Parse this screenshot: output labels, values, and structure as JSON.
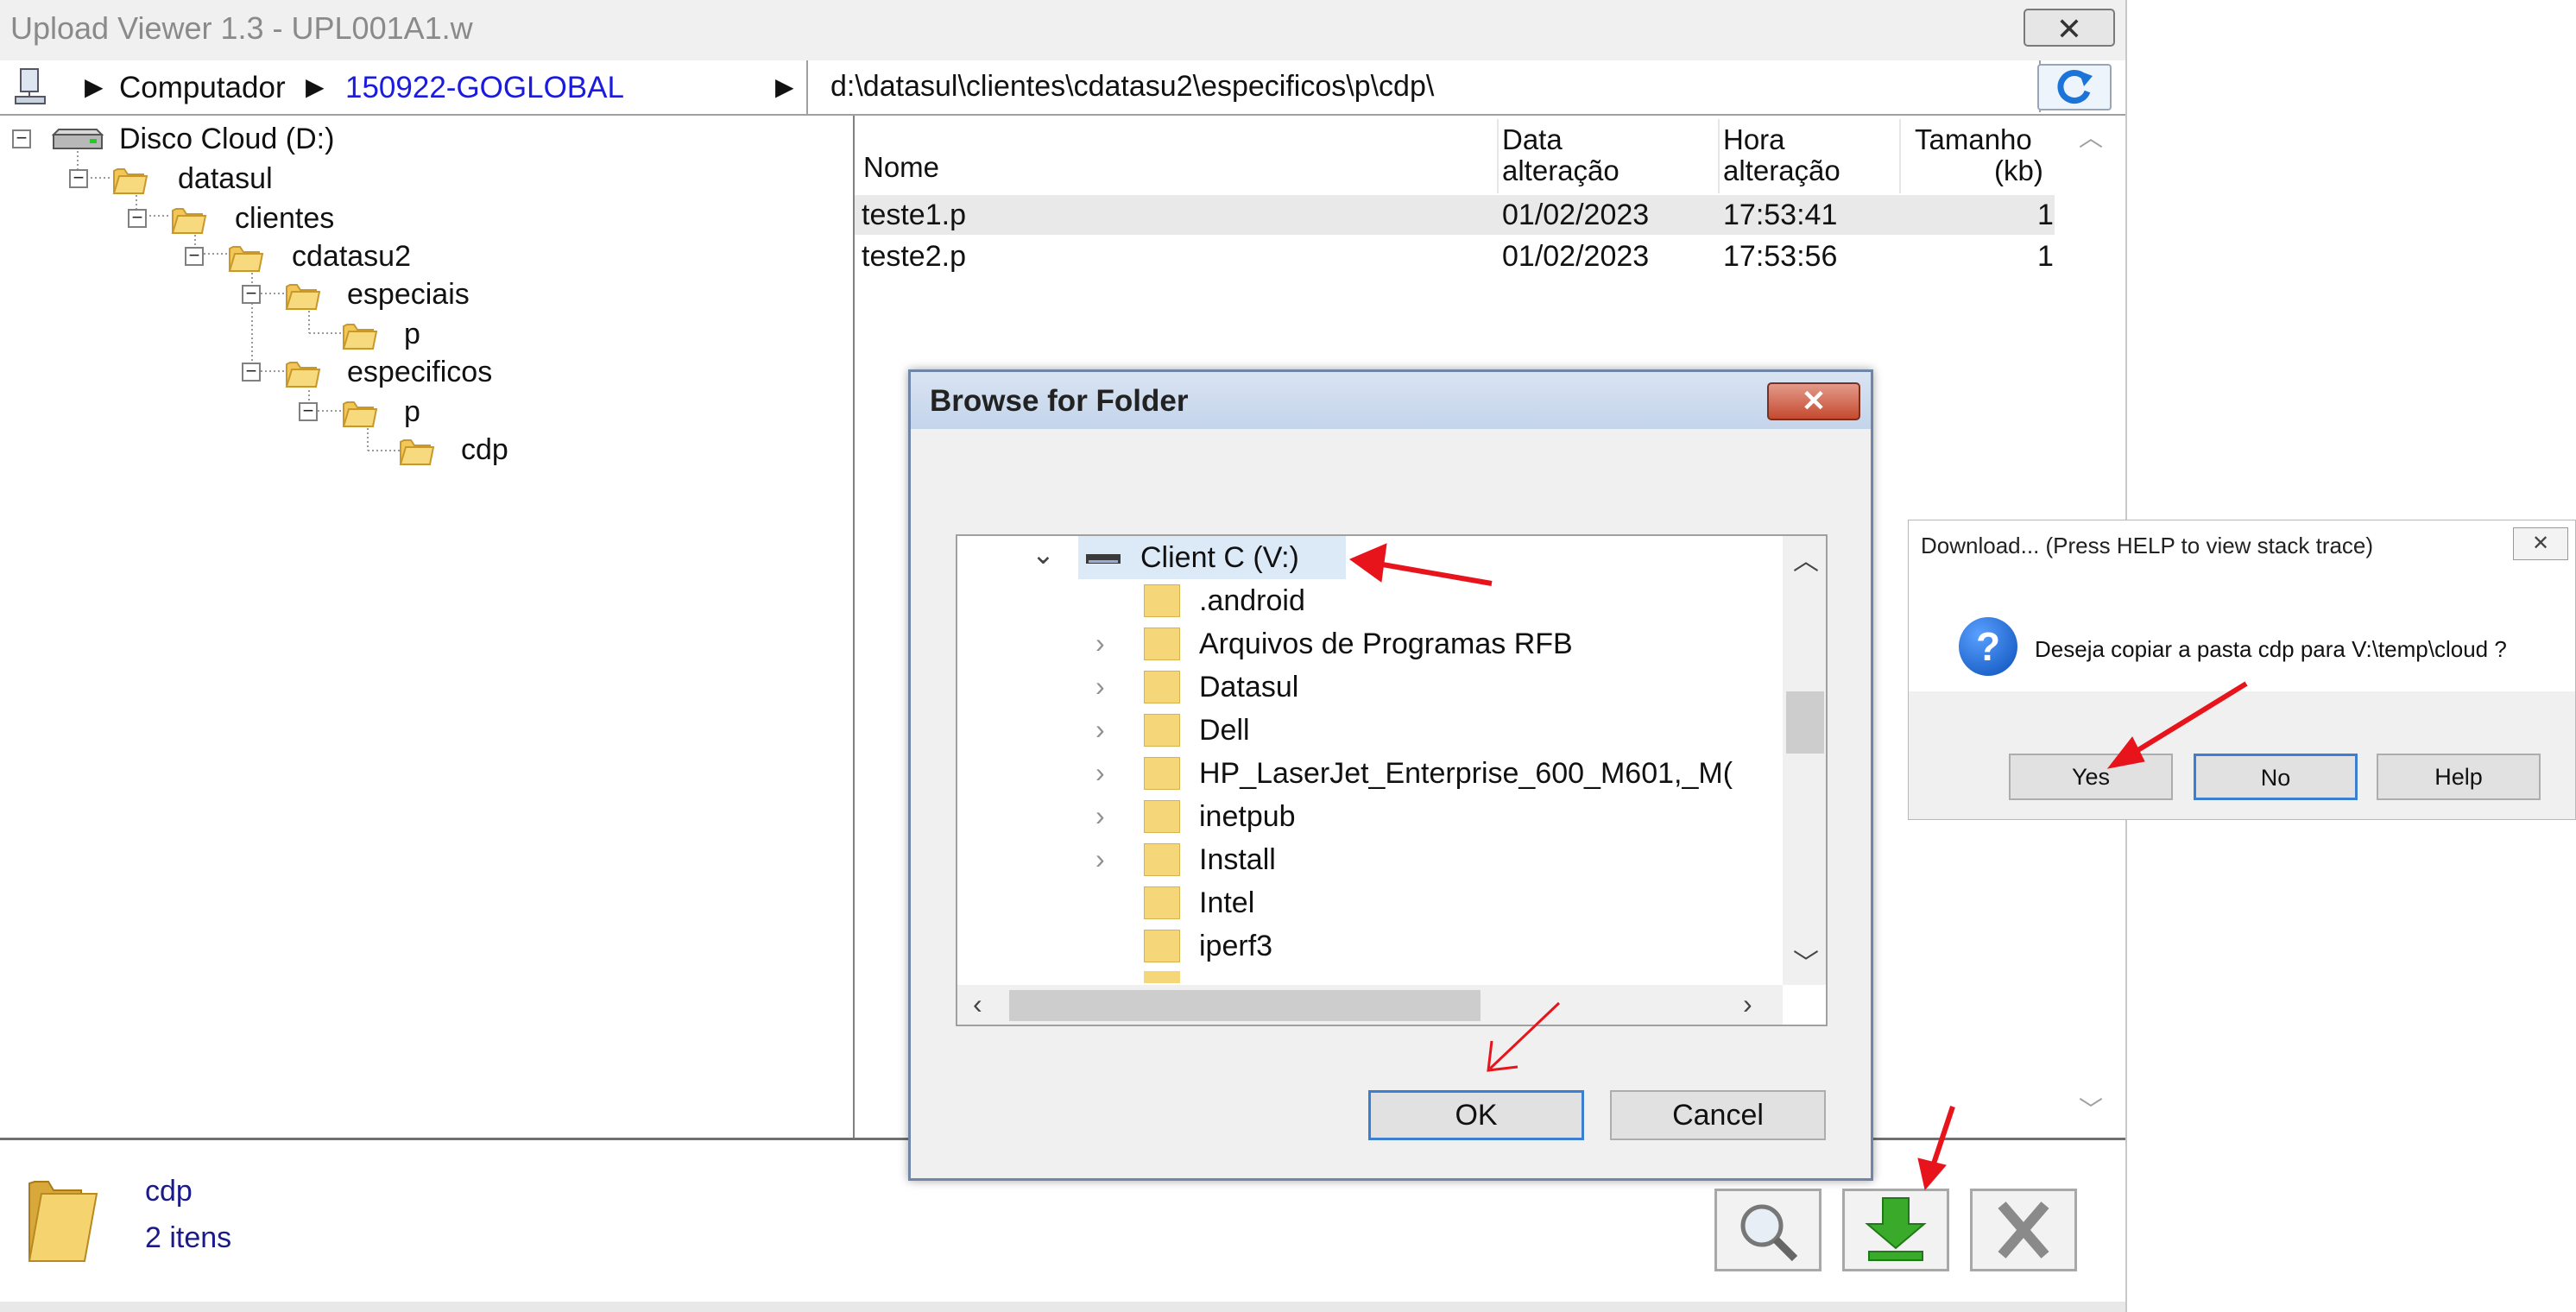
{
  "window": {
    "title": "Upload Viewer 1.3 - UPL001A1.w",
    "close_glyph": "✕"
  },
  "address": {
    "crumb_computer": "Computador",
    "crumb_host": "150922-GOGLOBAL",
    "arrow": "▶",
    "path": "d:\\datasul\\clientes\\cdatasu2\\especificos\\p\\cdp\\"
  },
  "tree": {
    "nodes": [
      {
        "label": "Disco Cloud (D:)"
      },
      {
        "label": "datasul"
      },
      {
        "label": "clientes"
      },
      {
        "label": "cdatasu2"
      },
      {
        "label": "especiais"
      },
      {
        "label": "p"
      },
      {
        "label": "especificos"
      },
      {
        "label": "p"
      },
      {
        "label": "cdp"
      }
    ]
  },
  "list": {
    "headers": {
      "name": "Nome",
      "date_l1": "Data",
      "date_l2": "alteração",
      "time_l1": "Hora",
      "time_l2": "alteração",
      "size_l1": "Tamanho",
      "size_l2": "(kb)"
    },
    "rows": [
      {
        "name": "teste1.p",
        "date": "01/02/2023",
        "time": "17:53:41",
        "size": "1"
      },
      {
        "name": "teste2.p",
        "date": "01/02/2023",
        "time": "17:53:56",
        "size": "1"
      }
    ]
  },
  "status": {
    "folder_name": "cdp",
    "item_count": "2 itens"
  },
  "browse_dialog": {
    "title": "Browse for Folder",
    "close_glyph": "✕",
    "root": "Client C (V:)",
    "items": [
      {
        "label": ".android",
        "expandable": false
      },
      {
        "label": "Arquivos de Programas RFB",
        "expandable": true
      },
      {
        "label": "Datasul",
        "expandable": true
      },
      {
        "label": "Dell",
        "expandable": true
      },
      {
        "label": "HP_LaserJet_Enterprise_600_M601,_M(",
        "expandable": true
      },
      {
        "label": "inetpub",
        "expandable": true
      },
      {
        "label": "Install",
        "expandable": true
      },
      {
        "label": "Intel",
        "expandable": false
      },
      {
        "label": "iperf3",
        "expandable": false
      }
    ],
    "ok_label": "OK",
    "cancel_label": "Cancel"
  },
  "download_dialog": {
    "title": "Download... (Press HELP to view stack trace)",
    "close_glyph": "✕",
    "message": "Deseja copiar a pasta cdp para V:\\temp\\cloud ?",
    "question_glyph": "?",
    "yes_label": "Yes",
    "no_label": "No",
    "help_label": "Help"
  },
  "colors": {
    "accent_red_arrow": "#e8141c",
    "host_link": "#1a1ae0",
    "status_text": "#1a1a8a"
  }
}
